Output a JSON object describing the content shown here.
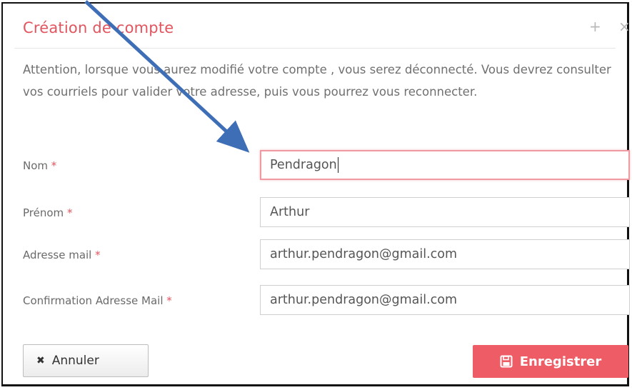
{
  "dialog": {
    "title": "Création de compte",
    "plus_icon": "+",
    "close_icon": "×"
  },
  "notice": "Attention, lorsque vous aurez modifié votre compte , vous serez déconnecté. Vous devrez consulter vos courriels pour valider votre adresse, puis vous pourrez vous reconnecter.",
  "form": {
    "required_mark": "*",
    "nom": {
      "label": "Nom",
      "value": "Pendragon"
    },
    "prenom": {
      "label": "Prénom",
      "value": "Arthur"
    },
    "email": {
      "label": "Adresse mail",
      "value": "arthur.pendragon@gmail.com"
    },
    "email_confirm": {
      "label": "Confirmation Adresse Mail",
      "value": "arthur.pendragon@gmail.com"
    }
  },
  "buttons": {
    "cancel_icon": "✖",
    "cancel_label": "Annuler",
    "save_icon": "🖫",
    "save_label": "Enregistrer"
  },
  "colors": {
    "accent": "#e2555f",
    "save_button": "#ee5c66",
    "arrow": "#3e6eb5"
  }
}
